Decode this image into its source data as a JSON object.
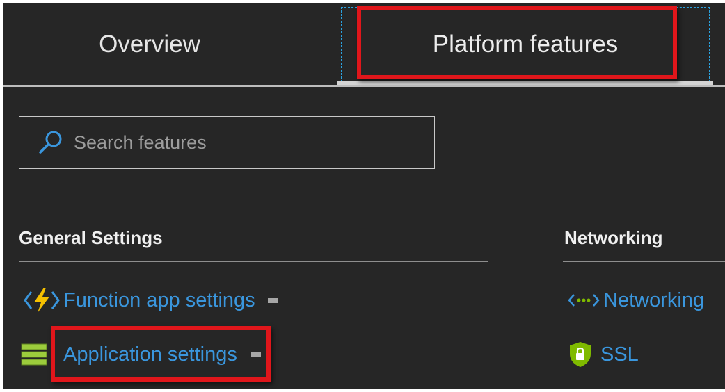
{
  "tabs": [
    {
      "label": "Overview"
    },
    {
      "label": "Platform features"
    }
  ],
  "search": {
    "placeholder": "Search features",
    "value": ""
  },
  "sections": {
    "general": {
      "heading": "General Settings",
      "items": [
        {
          "label": "Function app settings",
          "icon": "function-app-icon"
        },
        {
          "label": "Application settings",
          "icon": "app-settings-icon"
        }
      ]
    },
    "networking": {
      "heading": "Networking",
      "items": [
        {
          "label": "Networking",
          "icon": "networking-icon"
        },
        {
          "label": "SSL",
          "icon": "ssl-shield-icon"
        }
      ]
    }
  },
  "colors": {
    "background": "#262626",
    "link": "#3a96dd",
    "highlight": "#e0161b",
    "lightning": "#f5c000",
    "ssl_shield": "#7fba00"
  }
}
